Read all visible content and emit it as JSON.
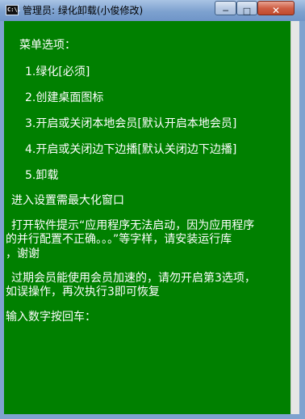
{
  "window": {
    "title": "管理员: 绿化卸载(小俊修改)",
    "icon_text": "C:\\.",
    "controls": {
      "minimize": "─",
      "maximize": "□",
      "close": "✕"
    }
  },
  "console": {
    "lines": [
      "菜单选项：",
      "1.绿化[必须]",
      "2.创建桌面图标",
      "3.开启或关闭本地会员[默认开启本地会员]",
      "4.开启或关闭边下边播[默认关闭边下边播]",
      "5.卸载",
      "进入设置需最大化窗口",
      "打开软件提示“应用程序无法启动，因为应用程序",
      "的并行配置不正确。。。”等字样，请安装运行库",
      "，谢谢",
      "过期会员能使用会员加速的，请勿开启第3选项，",
      "如误操作，再次执行3即可恢复",
      "输入数字按回车："
    ]
  },
  "colors": {
    "console_bg": "#008000",
    "console_text": "#ffffff"
  }
}
